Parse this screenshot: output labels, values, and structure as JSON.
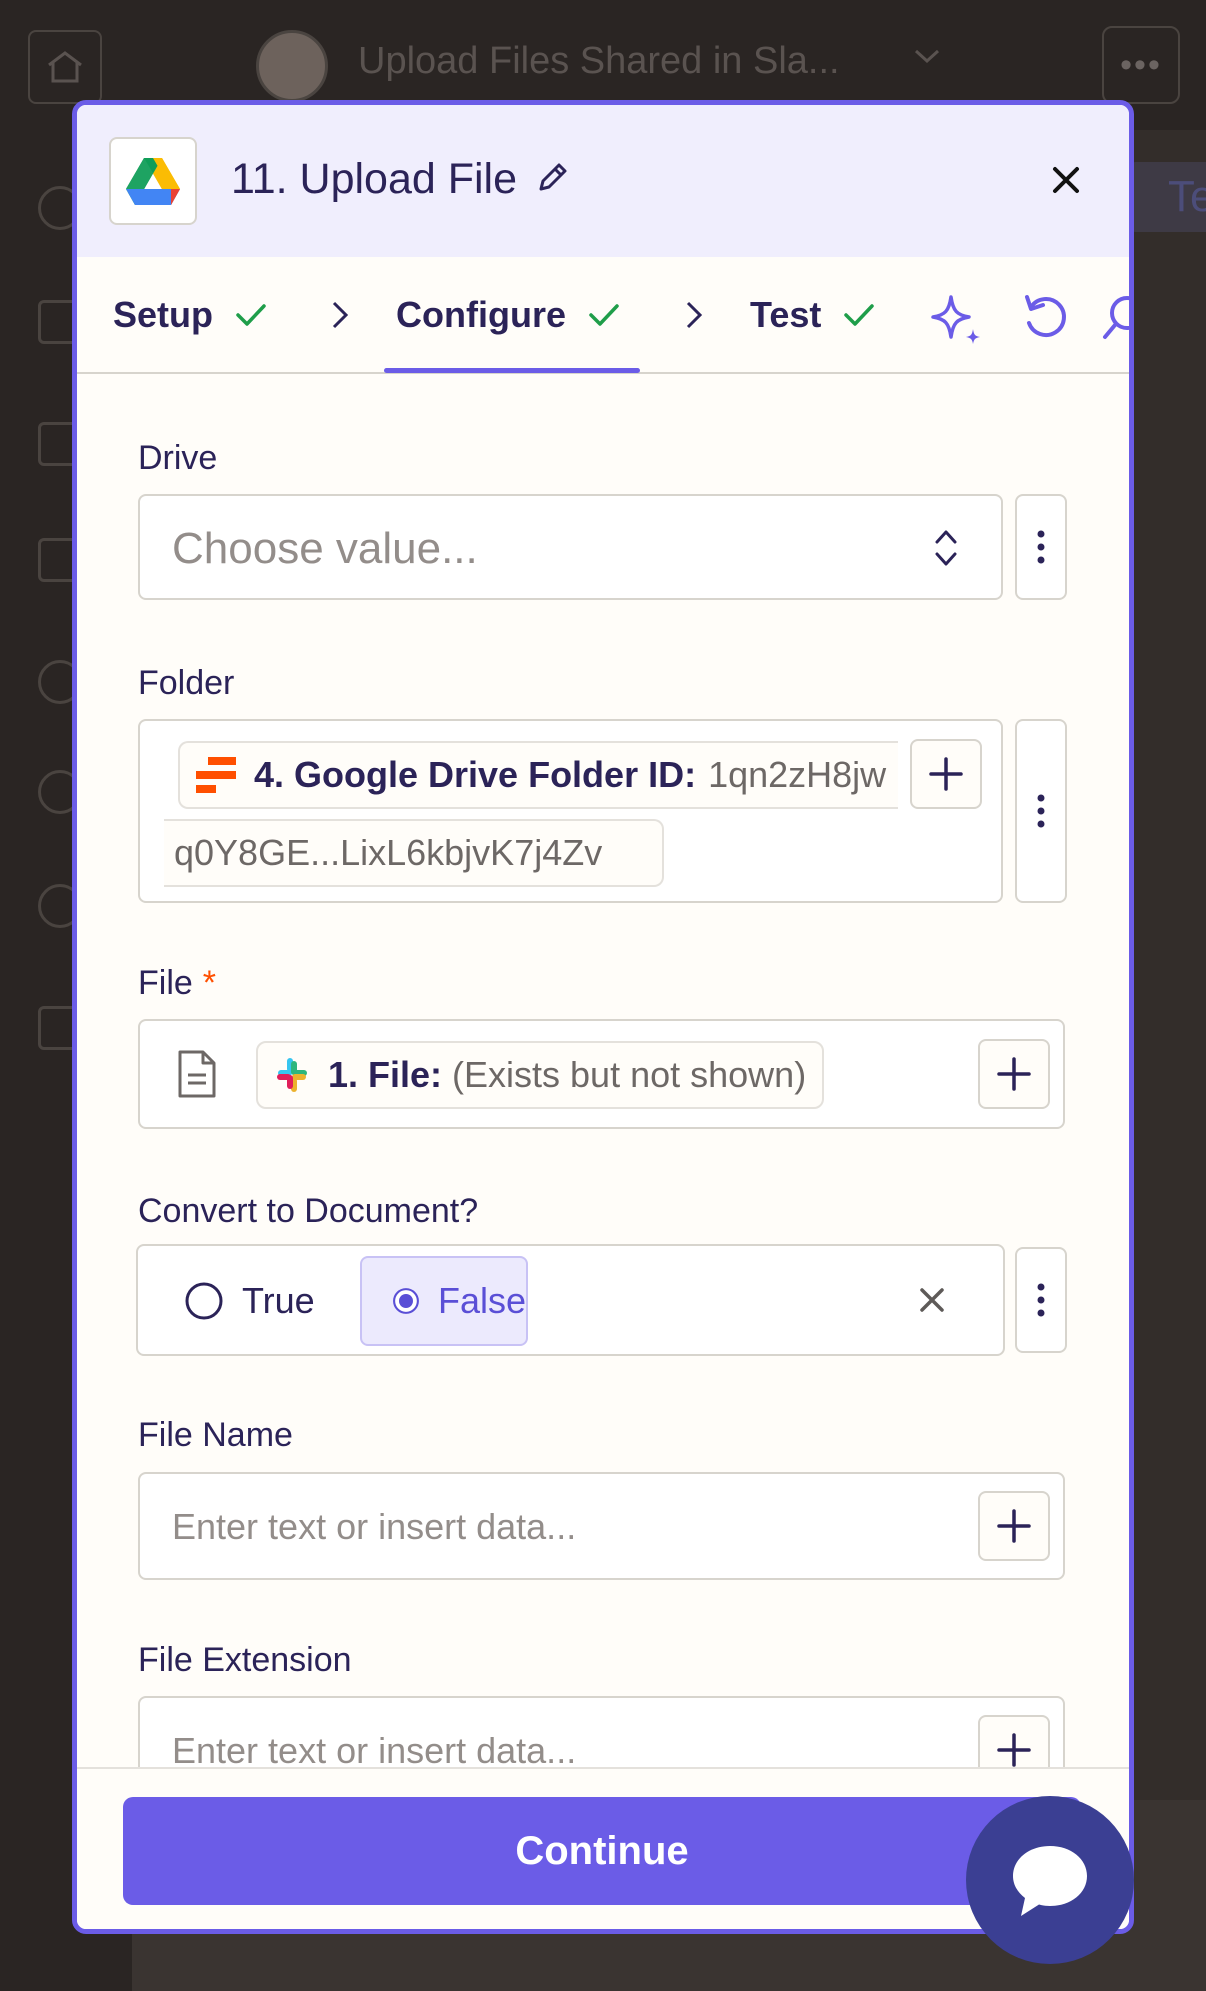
{
  "background": {
    "zap_title": "Upload Files Shared in Sla...",
    "side_tab_text": "Te"
  },
  "modal": {
    "step_title": "11. Upload File",
    "tabs": [
      {
        "label": "Setup",
        "complete": true
      },
      {
        "label": "Configure",
        "complete": true,
        "active": true
      },
      {
        "label": "Test",
        "complete": true
      }
    ],
    "fields": {
      "drive": {
        "label": "Drive",
        "placeholder": "Choose value..."
      },
      "folder": {
        "label": "Folder",
        "pill_label": "4. Google Drive Folder ID:",
        "pill_value_line1": "1qn2zH8jw",
        "pill_value_line2": "q0Y8GE...LixL6kbjvK7j4Zv"
      },
      "file": {
        "label": "File",
        "required_mark": "*",
        "pill_label": "1. File:",
        "pill_value": "(Exists but not shown)"
      },
      "convert": {
        "label": "Convert to Document?",
        "options": [
          {
            "label": "True",
            "selected": false
          },
          {
            "label": "False",
            "selected": true
          }
        ]
      },
      "file_name": {
        "label": "File Name",
        "placeholder": "Enter text or insert data..."
      },
      "file_extension": {
        "label": "File Extension",
        "placeholder": "Enter text or insert data..."
      }
    },
    "continue_label": "Continue"
  },
  "colors": {
    "accent": "#6b5ce7",
    "success": "#1f9e4a",
    "header_bg": "#f0eefd",
    "zapier_orange": "#ff4f00"
  }
}
